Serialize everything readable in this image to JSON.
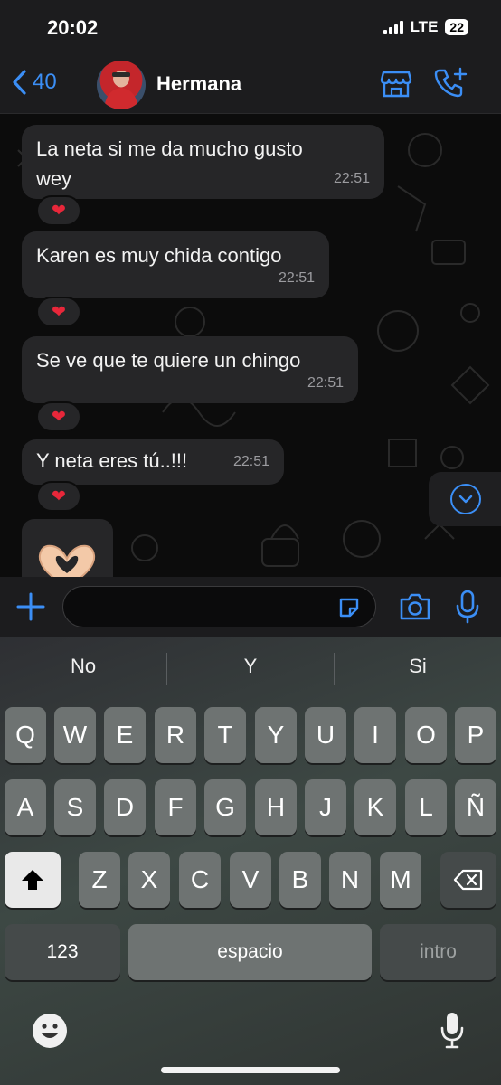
{
  "status_bar": {
    "time": "20:02",
    "network": "LTE",
    "battery": "22"
  },
  "header": {
    "back_count": "40",
    "contact_name": "Hermana"
  },
  "messages": [
    {
      "text_lines": [
        "La neta si me da mucho gusto",
        "wey"
      ],
      "time": "22:51",
      "reaction": "❤"
    },
    {
      "text_lines": [
        "Karen es muy chida contigo"
      ],
      "time": "22:51",
      "reaction": "❤"
    },
    {
      "text_lines": [
        "Se ve que te quiere un chingo"
      ],
      "time": "22:51",
      "reaction": "❤"
    },
    {
      "text_lines": [
        "Y neta eres tú..!!!"
      ],
      "time": "22:51",
      "reaction": "❤"
    }
  ],
  "input": {
    "placeholder": ""
  },
  "keyboard": {
    "suggestions": [
      "No",
      "Y",
      "Si"
    ],
    "row1": [
      "Q",
      "W",
      "E",
      "R",
      "T",
      "Y",
      "U",
      "I",
      "O",
      "P"
    ],
    "row2": [
      "A",
      "S",
      "D",
      "F",
      "G",
      "H",
      "J",
      "K",
      "L",
      "Ñ"
    ],
    "row3": [
      "Z",
      "X",
      "C",
      "V",
      "B",
      "N",
      "M"
    ],
    "numbers_label": "123",
    "space_label": "espacio",
    "return_label": "intro"
  },
  "colors": {
    "accent": "#3b8ef5",
    "bubble": "#262628",
    "heart": "#e8273a"
  }
}
